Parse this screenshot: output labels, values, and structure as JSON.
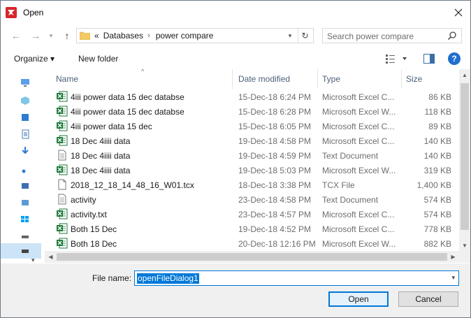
{
  "window": {
    "title": "Open"
  },
  "nav": {
    "address": {
      "root_symbol": "«",
      "segments": [
        "Databases",
        "power compare"
      ]
    },
    "search_placeholder": "Search power compare"
  },
  "toolbar": {
    "organize": "Organize ▾",
    "new_folder": "New folder",
    "help": "?"
  },
  "columns": {
    "name": "Name",
    "date": "Date modified",
    "type": "Type",
    "size": "Size"
  },
  "files": [
    {
      "name": "4iii power data 15 dec databse",
      "date": "15-Dec-18 6:24 PM",
      "type": "Microsoft Excel C...",
      "size": "86 KB",
      "icon": "excel-icon"
    },
    {
      "name": "4iii power data 15 dec databse",
      "date": "15-Dec-18 6:28 PM",
      "type": "Microsoft Excel W...",
      "size": "118 KB",
      "icon": "excel-icon"
    },
    {
      "name": "4iii power data 15 dec",
      "date": "15-Dec-18 6:05 PM",
      "type": "Microsoft Excel C...",
      "size": "89 KB",
      "icon": "excel-icon"
    },
    {
      "name": "18 Dec 4iiii data",
      "date": "19-Dec-18 4:58 PM",
      "type": "Microsoft Excel C...",
      "size": "140 KB",
      "icon": "excel-icon"
    },
    {
      "name": "18 Dec 4iiii data",
      "date": "19-Dec-18 4:59 PM",
      "type": "Text Document",
      "size": "140 KB",
      "icon": "text-icon"
    },
    {
      "name": "18 Dec 4iiii data",
      "date": "19-Dec-18 5:03 PM",
      "type": "Microsoft Excel W...",
      "size": "319 KB",
      "icon": "excel-icon"
    },
    {
      "name": "2018_12_18_14_48_16_W01.tcx",
      "date": "18-Dec-18 3:38 PM",
      "type": "TCX File",
      "size": "1,400 KB",
      "icon": "file-icon"
    },
    {
      "name": "activity",
      "date": "23-Dec-18 4:58 PM",
      "type": "Text Document",
      "size": "574 KB",
      "icon": "text-icon"
    },
    {
      "name": "activity.txt",
      "date": "23-Dec-18 4:57 PM",
      "type": "Microsoft Excel C...",
      "size": "574 KB",
      "icon": "excel-icon"
    },
    {
      "name": "Both 15 Dec",
      "date": "19-Dec-18 4:52 PM",
      "type": "Microsoft Excel C...",
      "size": "778 KB",
      "icon": "excel-icon"
    },
    {
      "name": "Both 18 Dec",
      "date": "20-Dec-18 12:16 PM",
      "type": "Microsoft Excel W...",
      "size": "882 KB",
      "icon": "excel-icon"
    }
  ],
  "bottom": {
    "file_name_label": "File name:",
    "file_name_value": "openFileDialog1",
    "open_label": "Open",
    "cancel_label": "Cancel"
  },
  "colors": {
    "accent": "#0078d7",
    "selection": "#cce4f7",
    "excel_green": "#1d7a3a"
  }
}
